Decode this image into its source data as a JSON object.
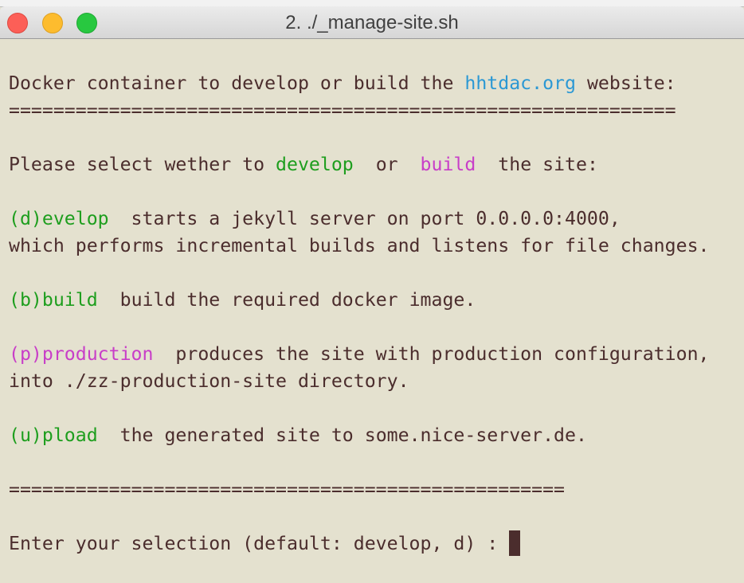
{
  "window": {
    "title": "2. ./_manage-site.sh"
  },
  "terminal": {
    "l1": [
      "Docker container to develop or build the ",
      "hhtdac.org",
      " website:"
    ],
    "sep1": "============================================================",
    "l2": [
      "Please select wether to ",
      "develop",
      "  or  ",
      "build",
      "  the site:"
    ],
    "l3": [
      "(d)evelop",
      "  starts a jekyll server on port 0.0.0.0:4000,"
    ],
    "l4": "which performs incremental builds and listens for file changes.",
    "l5": [
      "(b)build",
      "  build the required docker image."
    ],
    "l6": [
      "(p)production",
      "  produces the site with production configuration,"
    ],
    "l7": "into ./zz-production-site directory.",
    "l8": [
      "(u)pload",
      "  the generated site to some.nice-server.de."
    ],
    "sep2": "==================================================",
    "prompt": "Enter your selection (default: develop, d) : "
  },
  "colors": {
    "background": "#e4e1cf",
    "text": "#4b2d2d",
    "green": "#1e9e1e",
    "magenta": "#c83ec8",
    "link": "#2b98d4"
  }
}
